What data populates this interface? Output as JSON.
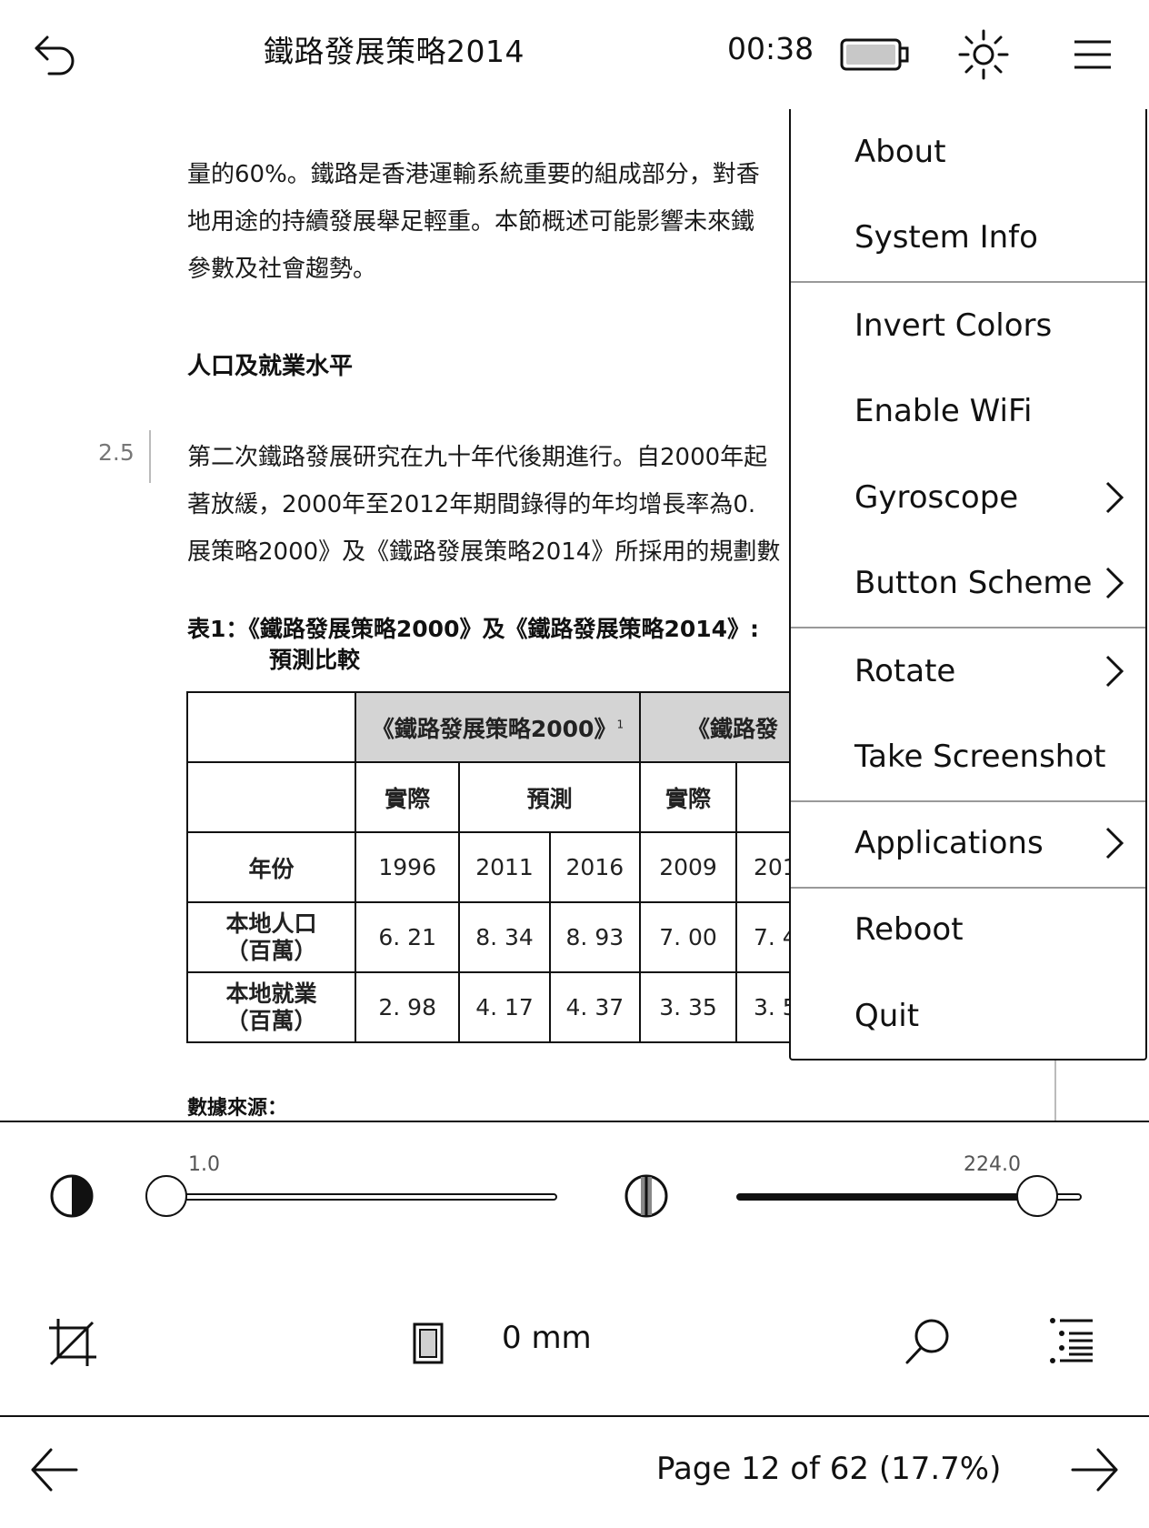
{
  "topbar": {
    "back_icon": "back-arrow-icon",
    "title": "鐵路發展策略2014",
    "clock": "00:38",
    "battery_icon": "battery-icon",
    "frontlight_icon": "frontlight-sun-icon",
    "menu_icon": "hamburger-menu-icon"
  },
  "document": {
    "lines": [
      "量的60%。鐵路是香港運輸系統重要的組成部分，對香",
      "地用途的持續發展舉足輕重。本節概述可能影響未來鐵",
      "參數及社會趨勢。"
    ],
    "heading": "人口及就業水平",
    "paragraph_number": "2.5",
    "para2": [
      "第二次鐵路發展研究在九十年代後期進行。自2000年起",
      "著放緩，2000年至2012年期間錄得的年均增長率為0.",
      "展策略2000》及《鐵路發展策略2014》所採用的規劃數"
    ],
    "table_caption_line1": "表1：《鐵路發展策略2000》及《鐵路發展策略2014》:",
    "table_caption_line2": "預測比較",
    "table": {
      "group1": "《鐵路發展策略2000》",
      "group1_sup": "1",
      "group2": "《鐵路發",
      "actual": "實際",
      "forecast": "預測",
      "actual2": "實際",
      "year_label": "年份",
      "years": [
        "1996",
        "2011",
        "2016",
        "2009",
        "201"
      ],
      "population_label_1": "本地人口",
      "population_label_2": "（百萬）",
      "population": [
        "6. 21",
        "8. 34",
        "8. 93",
        "7. 00",
        "7. 4"
      ],
      "employment_label_1": "本地就業",
      "employment_label_2": "（百萬）",
      "employment": [
        "2. 98",
        "4. 17",
        "4. 37",
        "3. 35",
        "3. 5"
      ]
    },
    "source_label": "數據來源："
  },
  "menu": {
    "items": [
      {
        "label": "About"
      },
      {
        "label": "System Info"
      },
      {
        "label": "Invert Colors"
      },
      {
        "label": "Enable WiFi"
      },
      {
        "label": "Gyroscope"
      },
      {
        "label": "Button Scheme"
      },
      {
        "label": "Rotate"
      },
      {
        "label": "Take Screenshot"
      },
      {
        "label": "Applications"
      },
      {
        "label": "Reboot"
      },
      {
        "label": "Quit"
      }
    ]
  },
  "sliders": {
    "contrast_icon": "contrast-icon",
    "contrast_value": "1.0",
    "gamma_icon": "gamma-icon",
    "gamma_value": "224.0"
  },
  "toolbar": {
    "crop_icon": "crop-icon",
    "margin_icon": "margin-icon",
    "margin_value": "0 mm",
    "search_icon": "search-icon",
    "toc_icon": "table-of-contents-icon"
  },
  "footer": {
    "prev_icon": "previous-page-arrow-icon",
    "page_info": "Page 12 of 62 (17.7%)",
    "next_icon": "next-page-arrow-icon"
  }
}
